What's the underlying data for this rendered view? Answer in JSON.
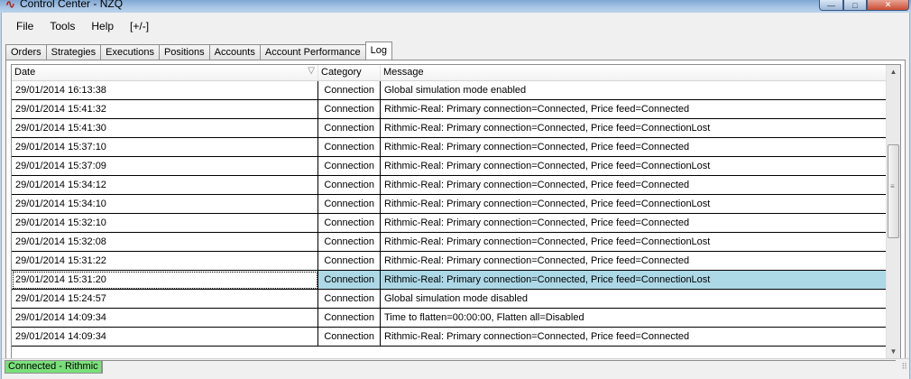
{
  "window": {
    "title": "Control Center - NZQ",
    "minimize_label": "—",
    "maximize_label": "□",
    "close_label": "✕"
  },
  "menu": {
    "items": [
      "File",
      "Tools",
      "Help",
      "[+/-]"
    ]
  },
  "tabs": [
    {
      "label": "Orders",
      "active": false
    },
    {
      "label": "Strategies",
      "active": false
    },
    {
      "label": "Executions",
      "active": false
    },
    {
      "label": "Positions",
      "active": false
    },
    {
      "label": "Accounts",
      "active": false
    },
    {
      "label": "Account Performance",
      "active": false
    },
    {
      "label": "Log",
      "active": true
    }
  ],
  "log": {
    "columns": {
      "date": "Date",
      "category": "Category",
      "message": "Message"
    },
    "sort_icon": "▽",
    "rows": [
      {
        "date": "29/01/2014 16:13:38",
        "category": "Connection",
        "message": "Global simulation mode enabled"
      },
      {
        "date": "29/01/2014 15:41:32",
        "category": "Connection",
        "message": "Rithmic-Real: Primary connection=Connected, Price feed=Connected"
      },
      {
        "date": "29/01/2014 15:41:30",
        "category": "Connection",
        "message": "Rithmic-Real: Primary connection=Connected, Price feed=ConnectionLost"
      },
      {
        "date": "29/01/2014 15:37:10",
        "category": "Connection",
        "message": "Rithmic-Real: Primary connection=Connected, Price feed=Connected"
      },
      {
        "date": "29/01/2014 15:37:09",
        "category": "Connection",
        "message": "Rithmic-Real: Primary connection=Connected, Price feed=ConnectionLost"
      },
      {
        "date": "29/01/2014 15:34:12",
        "category": "Connection",
        "message": "Rithmic-Real: Primary connection=Connected, Price feed=Connected"
      },
      {
        "date": "29/01/2014 15:34:10",
        "category": "Connection",
        "message": "Rithmic-Real: Primary connection=Connected, Price feed=ConnectionLost"
      },
      {
        "date": "29/01/2014 15:32:10",
        "category": "Connection",
        "message": "Rithmic-Real: Primary connection=Connected, Price feed=Connected"
      },
      {
        "date": "29/01/2014 15:32:08",
        "category": "Connection",
        "message": "Rithmic-Real: Primary connection=Connected, Price feed=ConnectionLost"
      },
      {
        "date": "29/01/2014 15:31:22",
        "category": "Connection",
        "message": "Rithmic-Real: Primary connection=Connected, Price feed=Connected"
      },
      {
        "date": "29/01/2014 15:31:20",
        "category": "Connection",
        "message": "Rithmic-Real: Primary connection=Connected, Price feed=ConnectionLost",
        "selected": true
      },
      {
        "date": "29/01/2014 15:24:57",
        "category": "Connection",
        "message": "Global simulation mode disabled"
      },
      {
        "date": "29/01/2014 14:09:34",
        "category": "Connection",
        "message": "Time to flatten=00:00:00, Flatten all=Disabled"
      },
      {
        "date": "29/01/2014 14:09:34",
        "category": "Connection",
        "message": "Rithmic-Real: Primary connection=Connected, Price feed=Connected"
      }
    ]
  },
  "status": {
    "connection": "Connected - Rithmic",
    "connection_color": "#7ae07a"
  },
  "colors": {
    "selected_row": "#add8e6",
    "title_icon": "#b3261e"
  }
}
